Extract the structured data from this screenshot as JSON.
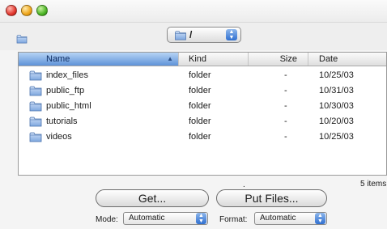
{
  "window": {
    "traffic_lights": [
      "close-button",
      "minimize-button",
      "zoom-button"
    ]
  },
  "path_popup": {
    "label": "/",
    "icon": "folder-icon"
  },
  "columns": {
    "name": "Name",
    "kind": "Kind",
    "size": "Size",
    "date": "Date"
  },
  "files": [
    {
      "name": "index_files",
      "kind": "folder",
      "size": "-",
      "date": "10/25/03"
    },
    {
      "name": "public_ftp",
      "kind": "folder",
      "size": "-",
      "date": "10/31/03"
    },
    {
      "name": "public_html",
      "kind": "folder",
      "size": "-",
      "date": "10/30/03"
    },
    {
      "name": "tutorials",
      "kind": "folder",
      "size": "-",
      "date": "10/20/03"
    },
    {
      "name": "videos",
      "kind": "folder",
      "size": "-",
      "date": "10/25/03"
    }
  ],
  "status": {
    "dot": ".",
    "items": "5 items"
  },
  "buttons": {
    "get": "Get...",
    "put": "Put Files..."
  },
  "options": {
    "mode_label": "Mode:",
    "mode_value": "Automatic",
    "format_label": "Format:",
    "format_value": "Automatic"
  },
  "colors": {
    "header_selected": "#5f93d8",
    "folder": "#8fb4e6"
  }
}
